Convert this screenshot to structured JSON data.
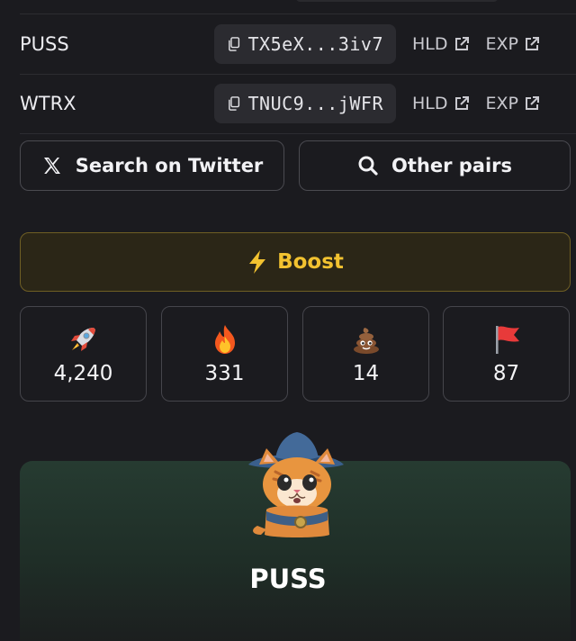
{
  "tokens": [
    {
      "name": "PUSS",
      "address": "TX5eX...3iv7",
      "link1": "HLD",
      "link2": "EXP"
    },
    {
      "name": "WTRX",
      "address": "TNUC9...jWFR",
      "link1": "HLD",
      "link2": "EXP"
    }
  ],
  "actions": {
    "twitter_label": "Search on Twitter",
    "pairs_label": "Other pairs",
    "boost_label": "Boost"
  },
  "stats": [
    {
      "icon": "rocket-icon",
      "count": "4,240"
    },
    {
      "icon": "fire-icon",
      "count": "331"
    },
    {
      "icon": "poop-icon",
      "count": "14"
    },
    {
      "icon": "red-flag-icon",
      "count": "87"
    }
  ],
  "profile": {
    "name": "PUSS"
  },
  "colors": {
    "background": "#1b1b1f",
    "boost": "#f2c230",
    "card_green": "#263b31"
  }
}
